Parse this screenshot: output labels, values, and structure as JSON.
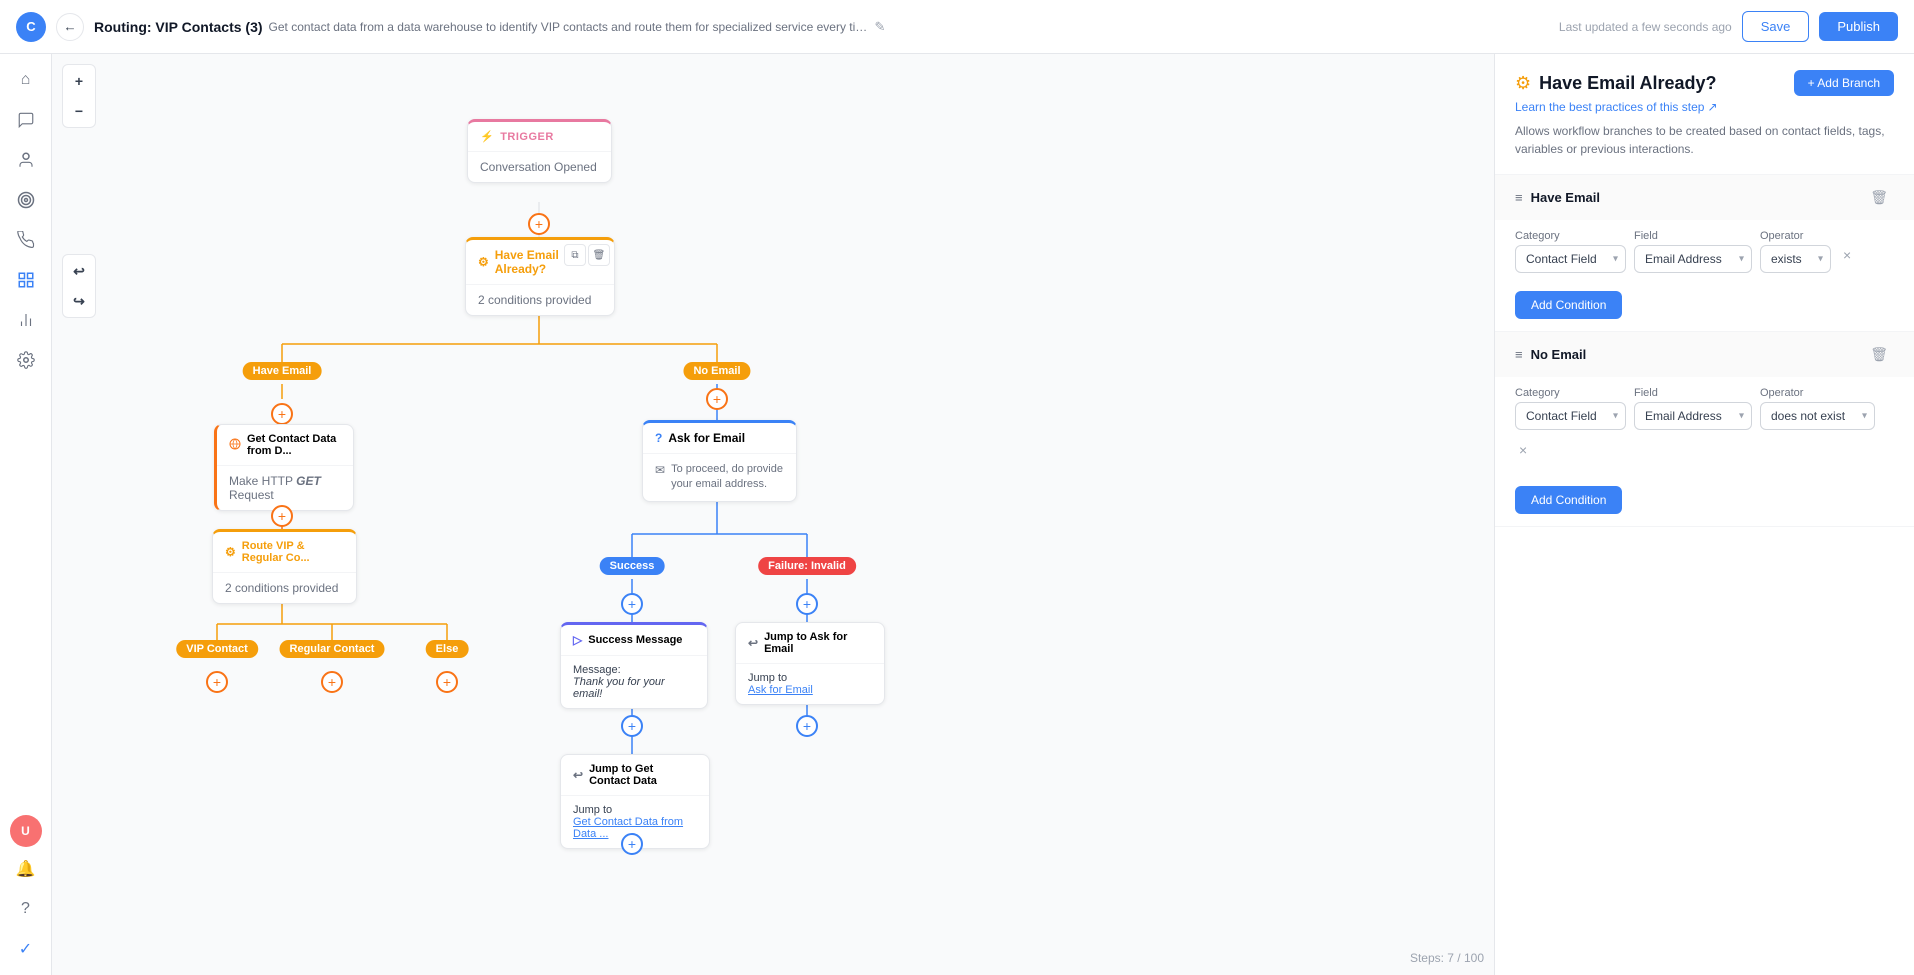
{
  "topbar": {
    "avatar_label": "C",
    "back_label": "←",
    "route_prefix": "Routing: VIP Contacts (3)",
    "route_desc": "Get contact data from a data warehouse to identify VIP contacts and route them for specialized service every time a contact starts a conversation.",
    "edit_icon": "✎",
    "last_updated": "Last updated a few seconds ago",
    "save_label": "Save",
    "publish_label": "Publish"
  },
  "sidebar": {
    "icons": [
      {
        "name": "home",
        "symbol": "⌂",
        "active": false
      },
      {
        "name": "chat",
        "symbol": "💬",
        "active": false
      },
      {
        "name": "contact",
        "symbol": "👤",
        "active": false
      },
      {
        "name": "target",
        "symbol": "◎",
        "active": false
      },
      {
        "name": "broadcast",
        "symbol": "📡",
        "active": false
      },
      {
        "name": "flow",
        "symbol": "⬡",
        "active": true
      },
      {
        "name": "chart",
        "symbol": "▦",
        "active": false
      },
      {
        "name": "settings",
        "symbol": "⚙",
        "active": false
      }
    ]
  },
  "canvas": {
    "zoom_in": "+",
    "zoom_out": "−",
    "undo": "↩",
    "redo": "↪",
    "step_counter": "Steps: 7 / 100"
  },
  "nodes": {
    "trigger": {
      "label": "Trigger",
      "body": "Conversation Opened"
    },
    "have_email": {
      "label": "Have Email Already?",
      "body": "2 conditions provided"
    },
    "get_contact": {
      "label": "Get Contact Data from D...",
      "body": "Make HTTP GET Request"
    },
    "route_vip": {
      "label": "Route VIP & Regular Co...",
      "body": "2 conditions provided"
    },
    "ask_email": {
      "label": "Ask for Email",
      "body": "To proceed, do provide your email address."
    },
    "success_msg": {
      "label": "Success Message",
      "body_label": "Message:",
      "body": "Thank you for your email!"
    },
    "jump_ask": {
      "label": "Jump to Ask for Email",
      "jump_to": "Jump to",
      "jump_link": "Ask for Email"
    },
    "jump_get": {
      "label": "Jump to Get Contact Data",
      "jump_to": "Jump to",
      "jump_link": "Get Contact Data from Data ..."
    }
  },
  "branches": {
    "have_email_label": "Have Email",
    "no_email_label": "No Email",
    "vip_label": "VIP Contact",
    "regular_label": "Regular Contact",
    "else_label": "Else",
    "success_label": "Success",
    "failure_label": "Failure: Invalid"
  },
  "right_panel": {
    "icon": "⚙",
    "title": "Have Email Already?",
    "learn_text": "Learn the best practices of this step",
    "external_icon": "↗",
    "desc": "Allows workflow branches to be created based on contact fields, tags, variables or previous interactions.",
    "add_branch_label": "+ Add Branch",
    "section1": {
      "icon": "≡",
      "title": "Have Email",
      "delete_icon": "🗑",
      "category_label": "Category",
      "field_label": "Field",
      "operator_label": "Operator",
      "category_value": "Contact Field",
      "field_value": "Email Address",
      "operator_value": "exists",
      "add_condition_label": "Add Condition"
    },
    "section2": {
      "icon": "≡",
      "title": "No Email",
      "delete_icon": "🗑",
      "category_label": "Category",
      "field_label": "Field",
      "operator_label": "Operator",
      "category_value": "Contact Field",
      "field_value": "Email Address",
      "operator_value": "does not exist",
      "add_condition_label": "Add Condition"
    }
  }
}
